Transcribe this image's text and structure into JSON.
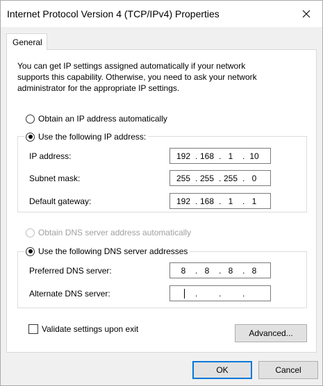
{
  "window": {
    "title": "Internet Protocol Version 4 (TCP/IPv4) Properties"
  },
  "tabs": [
    {
      "label": "General"
    }
  ],
  "description": {
    "lines": [
      "You can get IP settings assigned automatically if your network",
      "supports this capability. Otherwise, you need to ask your network",
      "administrator for the appropriate IP settings."
    ]
  },
  "ip": {
    "auto_label": "Obtain an IP address automatically",
    "manual_label": "Use the following IP address:",
    "selected": "manual",
    "fields": [
      {
        "label": "IP address:",
        "octets": [
          "192",
          "168",
          "1",
          "10"
        ]
      },
      {
        "label": "Subnet mask:",
        "octets": [
          "255",
          "255",
          "255",
          "0"
        ]
      },
      {
        "label": "Default gateway:",
        "octets": [
          "192",
          "168",
          "1",
          "1"
        ]
      }
    ]
  },
  "dns": {
    "auto_label": "Obtain DNS server address automatically",
    "manual_label": "Use the following DNS server addresses",
    "selected": "manual",
    "auto_disabled": true,
    "fields": [
      {
        "label": "Preferred DNS server:",
        "octets": [
          "8",
          "8",
          "8",
          "8"
        ]
      },
      {
        "label": "Alternate DNS server:",
        "octets": [
          "",
          "",
          "",
          ""
        ]
      }
    ]
  },
  "validate": {
    "label": "Validate settings upon exit",
    "checked": false
  },
  "buttons": {
    "advanced": "Advanced...",
    "ok": "OK",
    "cancel": "Cancel"
  },
  "colors": {
    "accent": "#0078d7",
    "button_bg": "#e1e1e1"
  }
}
